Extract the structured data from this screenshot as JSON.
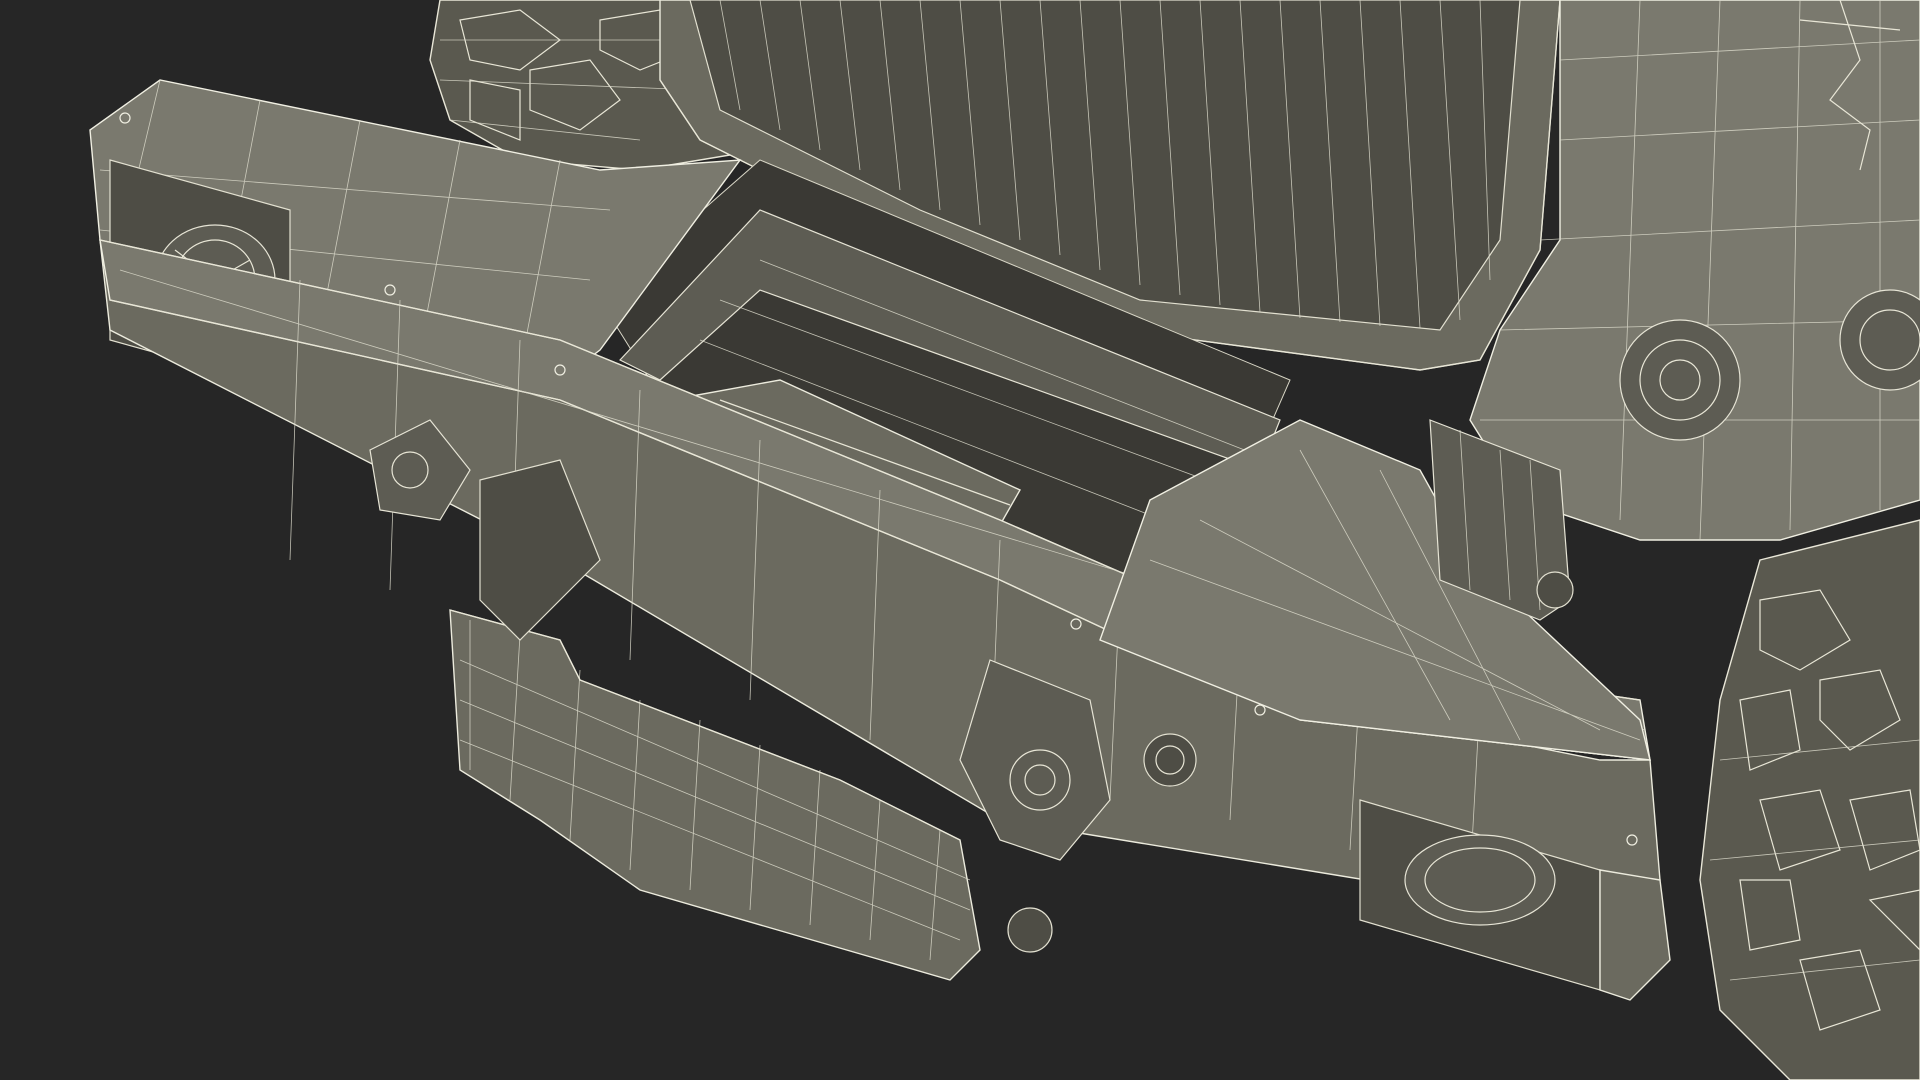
{
  "scene": {
    "subject": "",
    "colors": {
      "background": "#262626",
      "mesh_fill": "#6b6a5f",
      "wire": "#e8e6d6"
    }
  }
}
